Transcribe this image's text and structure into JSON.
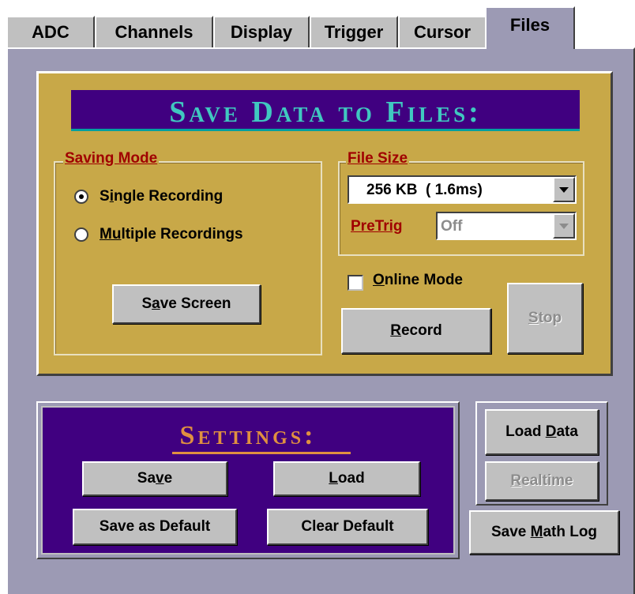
{
  "tabs": [
    {
      "label": "ADC",
      "active": false
    },
    {
      "label": "Channels",
      "active": false
    },
    {
      "label": "Display",
      "active": false
    },
    {
      "label": "Trigger",
      "active": false
    },
    {
      "label": "Cursor",
      "active": false
    },
    {
      "label": "Files",
      "active": true
    }
  ],
  "save_panel": {
    "title": "Save Data to Files:",
    "saving_mode": {
      "label": "Saving Mode",
      "options": [
        {
          "pre": "S",
          "key": "i",
          "post": "ngle Recording",
          "selected": true
        },
        {
          "pre": "",
          "key": "Mu",
          "post": "ltiple Recordings",
          "selected": false
        }
      ],
      "save_screen": {
        "pre": "S",
        "key": "a",
        "post": "ve Screen"
      }
    },
    "file_size": {
      "label": "File Size",
      "value": "256 KB  ( 1.6ms)",
      "pretrig_label": "PreTrig",
      "pretrig_value": "Off"
    },
    "online_mode": {
      "key": "O",
      "post": "nline Mode",
      "checked": false
    },
    "record": {
      "key": "R",
      "post": "ecord"
    },
    "stop": {
      "key": "S",
      "post": "top",
      "disabled": true
    }
  },
  "settings": {
    "title": "Settings:",
    "save": {
      "pre": "Sa",
      "key": "v",
      "post": "e"
    },
    "load": {
      "key": "L",
      "post": "oad"
    },
    "save_default": "Save as Default",
    "clear_default": "Clear Default"
  },
  "side": {
    "load_data": {
      "pre": "Load ",
      "key": "D",
      "post": "ata"
    },
    "realtime": {
      "key": "R",
      "post": "ealtime",
      "disabled": true
    },
    "save_math_log": {
      "pre": "Save ",
      "key": "M",
      "post": "ath Log"
    }
  },
  "colors": {
    "panel_bg": "#9c9ab4",
    "gold": "#c8a848",
    "purple": "#400080",
    "title_cyan": "#40c8c0",
    "settings_orange": "#e09040",
    "label_red": "#a00000"
  }
}
